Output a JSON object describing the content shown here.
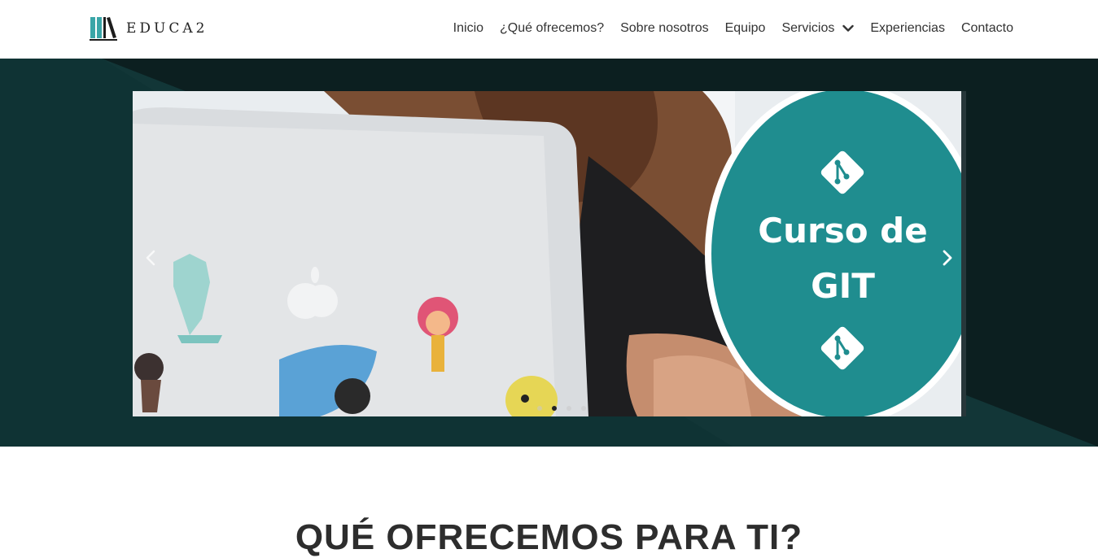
{
  "brand": {
    "name": "EDUCA2"
  },
  "nav": {
    "items": [
      {
        "label": "Inicio"
      },
      {
        "label": "¿Qué ofrecemos?"
      },
      {
        "label": "Sobre nosotros"
      },
      {
        "label": "Equipo"
      },
      {
        "label": "Servicios",
        "has_dropdown": true,
        "icon": "chevron-down-icon"
      },
      {
        "label": "Experiencias"
      },
      {
        "label": "Contacto"
      }
    ]
  },
  "carousel": {
    "slide_title_line1": "Curso de",
    "slide_title_line2": "GIT",
    "prev_icon": "chevron-left-icon",
    "next_icon": "chevron-right-icon",
    "slide_count": 4,
    "active_index": 1
  },
  "section": {
    "title": "QUÉ OFRECEMOS PARA TI?"
  },
  "colors": {
    "hero_dark": "#0f2a2b",
    "teal_badge": "#1f8d8f",
    "logo_teal": "#3aa6a8",
    "nav_text": "#333333"
  }
}
